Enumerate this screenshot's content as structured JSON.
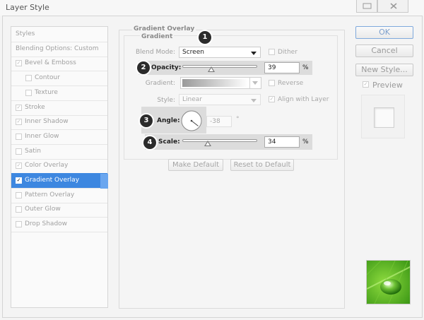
{
  "window": {
    "title": "Layer Style"
  },
  "sidebar": {
    "items": [
      {
        "label": "Styles",
        "checkbox": false,
        "checked": false,
        "indent": 0
      },
      {
        "label": "Blending Options: Custom",
        "checkbox": false,
        "checked": false,
        "indent": 0
      },
      {
        "label": "Bevel & Emboss",
        "checkbox": true,
        "checked": true,
        "indent": 0
      },
      {
        "label": "Contour",
        "checkbox": true,
        "checked": false,
        "indent": 1
      },
      {
        "label": "Texture",
        "checkbox": true,
        "checked": false,
        "indent": 1
      },
      {
        "label": "Stroke",
        "checkbox": true,
        "checked": true,
        "indent": 0
      },
      {
        "label": "Inner Shadow",
        "checkbox": true,
        "checked": true,
        "indent": 0
      },
      {
        "label": "Inner Glow",
        "checkbox": true,
        "checked": false,
        "indent": 0
      },
      {
        "label": "Satin",
        "checkbox": true,
        "checked": false,
        "indent": 0
      },
      {
        "label": "Color Overlay",
        "checkbox": true,
        "checked": true,
        "indent": 0
      },
      {
        "label": "Gradient Overlay",
        "checkbox": true,
        "checked": true,
        "indent": 0,
        "active": true
      },
      {
        "label": "Pattern Overlay",
        "checkbox": true,
        "checked": false,
        "indent": 0
      },
      {
        "label": "Outer Glow",
        "checkbox": true,
        "checked": false,
        "indent": 0
      },
      {
        "label": "Drop Shadow",
        "checkbox": true,
        "checked": false,
        "indent": 0
      }
    ]
  },
  "panel": {
    "title": "Gradient Overlay",
    "group": "Gradient",
    "blend_mode": {
      "label": "Blend Mode:",
      "value": "Screen"
    },
    "dither": {
      "label": "Dither",
      "checked": false
    },
    "opacity": {
      "label": "Opacity:",
      "value": "39",
      "unit": "%",
      "level": 0.39
    },
    "gradient": {
      "label": "Gradient:"
    },
    "reverse": {
      "label": "Reverse",
      "checked": false
    },
    "style": {
      "label": "Style:",
      "value": "Linear"
    },
    "align": {
      "label": "Align with Layer",
      "checked": true
    },
    "angle": {
      "label": "Angle:",
      "value": "-38",
      "unit": "°",
      "degrees": -38
    },
    "scale": {
      "label": "Scale:",
      "value": "34",
      "unit": "%",
      "level": 0.34
    },
    "make_default": "Make Default",
    "reset_default": "Reset to Default",
    "callouts": [
      "1",
      "2",
      "3",
      "4"
    ]
  },
  "buttons": {
    "ok": "OK",
    "cancel": "Cancel",
    "new_style": "New Style...",
    "preview": "Preview",
    "preview_checked": true
  },
  "colors": {
    "accent": "#3d87e0",
    "leaf": "#5cb82c"
  }
}
